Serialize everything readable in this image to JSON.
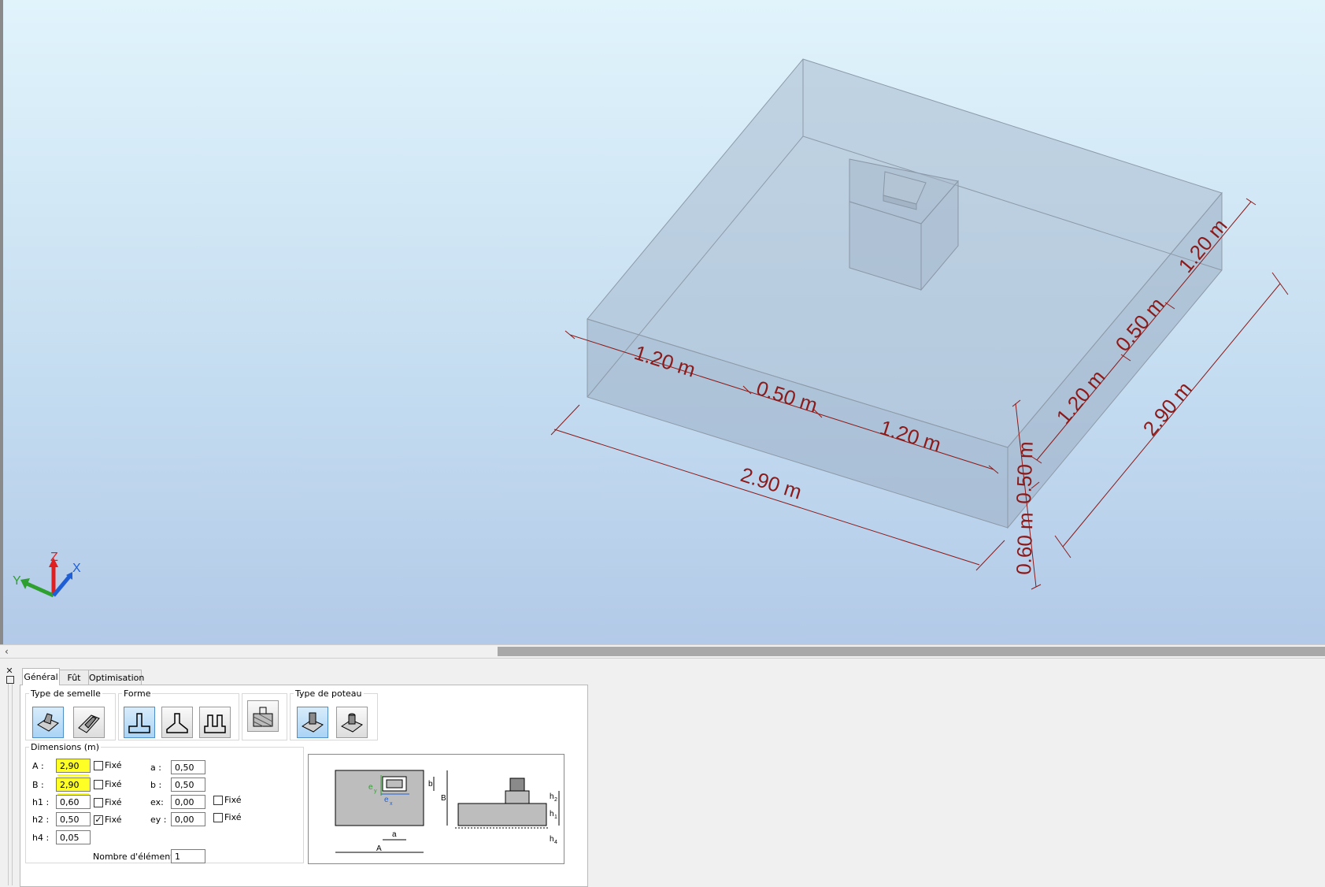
{
  "colors": {
    "dimension": "#8b1a1a",
    "footing_face": "#a9bccf",
    "axis_x": "#1f5fd6",
    "axis_y": "#2ea02e",
    "axis_z": "#e02020",
    "highlight": "#ffff26"
  },
  "viewport": {
    "dimensions": {
      "front_a": "1.20 m",
      "front_b": "0.50 m",
      "front_c": "1.20 m",
      "front_total": "2.90 m",
      "side_a": "1.20 m",
      "side_b": "0.50 m",
      "side_c": "1.20 m",
      "side_total": "2.90 m",
      "height_upper": "0.50 m",
      "height_total": "0.60 m"
    },
    "axes": {
      "x": "X",
      "y": "Y",
      "z": "Z"
    }
  },
  "panel": {
    "tabs": [
      "Général",
      "Fût",
      "Optimisation"
    ],
    "active_tab": "Général",
    "groups": {
      "type_semelle": "Type de semelle",
      "forme": "Forme",
      "type_poteau": "Type de poteau",
      "dimensions": "Dimensions (m)"
    },
    "icons": {
      "type_semelle": [
        "isolated-footing-icon",
        "strip-footing-icon"
      ],
      "forme": [
        "rect-shape-icon",
        "tapered-shape-icon",
        "stepped-shape-icon"
      ],
      "extra": "soil-block-icon",
      "type_poteau": [
        "rect-column-icon",
        "round-column-icon"
      ]
    },
    "fields": {
      "A": {
        "label": "A :",
        "value": "2,90",
        "fixed": false,
        "fixed_label": "Fixé"
      },
      "B": {
        "label": "B :",
        "value": "2,90",
        "fixed": false,
        "fixed_label": "Fixé"
      },
      "h1": {
        "label": "h1 :",
        "value": "0,60",
        "fixed": false,
        "fixed_label": "Fixé"
      },
      "h2": {
        "label": "h2 :",
        "value": "0,50",
        "fixed": true,
        "fixed_label": "Fixé"
      },
      "h4": {
        "label": "h4 :",
        "value": "0,05"
      },
      "a": {
        "label": "a :",
        "value": "0,50"
      },
      "b": {
        "label": "b :",
        "value": "0,50"
      },
      "ex": {
        "label": "ex:",
        "value": "0,00",
        "fixed": false,
        "fixed_label": "Fixé"
      },
      "ey": {
        "label": "ey :",
        "value": "0,00",
        "fixed": false,
        "fixed_label": "Fixé"
      },
      "nombre": {
        "label": "Nombre d'éléments:",
        "value": "1"
      }
    },
    "schema_labels": {
      "A": "A",
      "B": "B",
      "a": "a",
      "b": "b",
      "ex": "e",
      "ex_sub": "x",
      "ey": "e",
      "ey_sub": "y",
      "h1": "h",
      "h1_sub": "1",
      "h2": "h",
      "h2_sub": "2",
      "h4": "h",
      "h4_sub": "4"
    }
  }
}
